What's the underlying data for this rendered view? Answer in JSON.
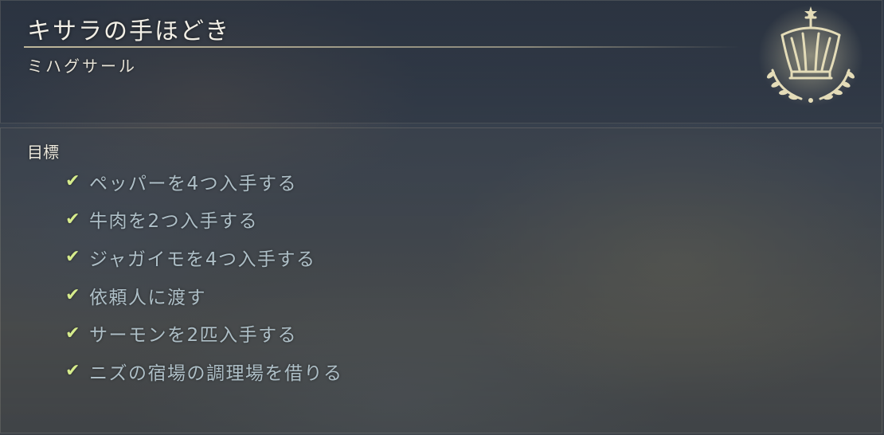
{
  "quest": {
    "title": "キサラの手ほどき",
    "giver": "ミハグサール",
    "emblem_icon": "crown-laurel-icon"
  },
  "objectives": {
    "heading": "目標",
    "check_icon": "✔",
    "items": [
      {
        "label": "ペッパーを4つ入手する",
        "completed": true
      },
      {
        "label": "牛肉を2つ入手する",
        "completed": true
      },
      {
        "label": "ジャガイモを4つ入手する",
        "completed": true
      },
      {
        "label": "依頼人に渡す",
        "completed": true
      },
      {
        "label": "サーモンを2匹入手する",
        "completed": true
      },
      {
        "label": "ニズの宿場の調理場を借りる",
        "completed": true
      }
    ]
  },
  "colors": {
    "check": "#d6ec8c",
    "objective_text": "#aebfc7",
    "title_text": "#f2efe6",
    "emblem": "#d8cfa8"
  }
}
